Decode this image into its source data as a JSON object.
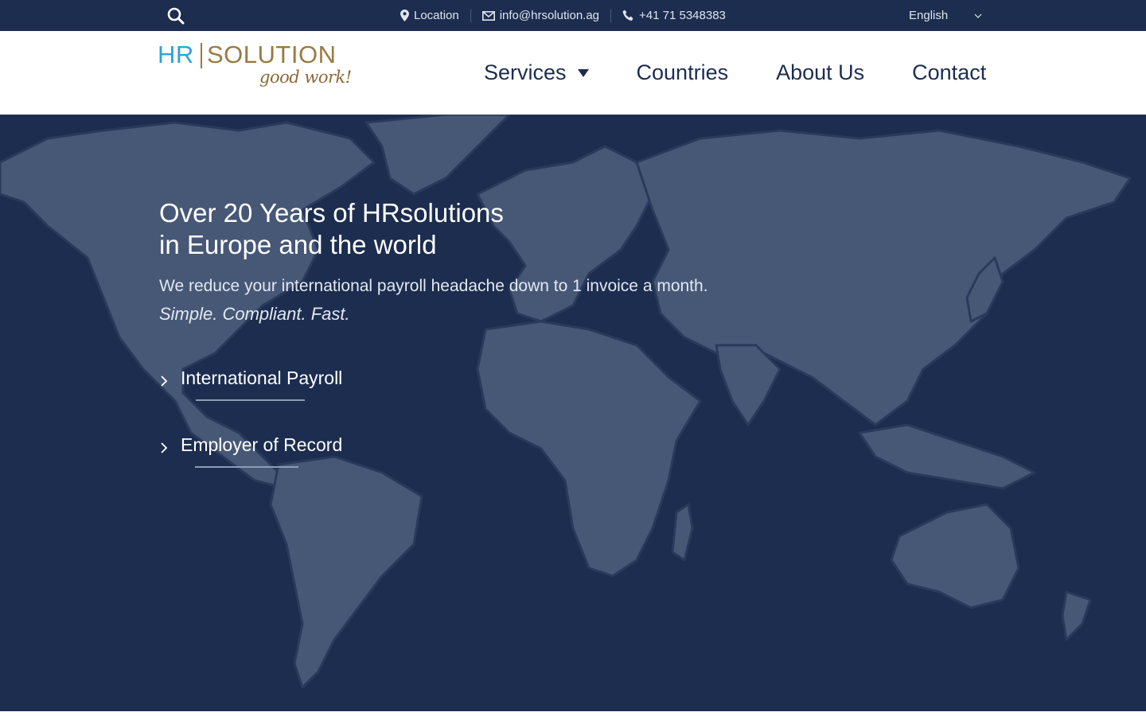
{
  "topbar": {
    "search_icon": "search-icon",
    "location_label": "Location",
    "email_label": "info@hrsolution.ag",
    "phone_label": "+41 71 5348383",
    "language": "English"
  },
  "logo": {
    "brand_left": "HR",
    "brand_right": "SOLUTION",
    "tagline": "good work!"
  },
  "nav": {
    "items": [
      "Services",
      "Countries",
      "About Us",
      "Contact"
    ]
  },
  "hero": {
    "title_line1": "Over 20 Years of HRsolutions",
    "title_line2": "in Europe and the world",
    "lead": "We reduce your international payroll headache down to 1 invoice a month.",
    "tagline": "Simple. Compliant. Fast.",
    "links": [
      "International Payroll",
      "Employer of Record"
    ]
  },
  "colors": {
    "navy": "#1c2d4f",
    "map_land": "#475877",
    "brand_blue": "#2ea2d6",
    "brand_gold": "#9a7a43"
  }
}
